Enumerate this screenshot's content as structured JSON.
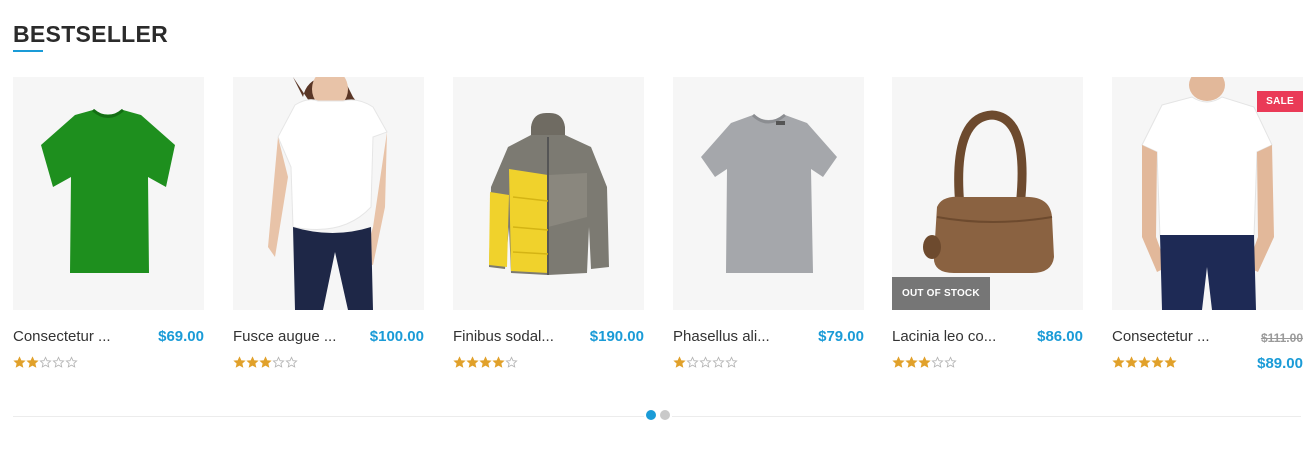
{
  "section": {
    "title": "BESTSELLER"
  },
  "products": [
    {
      "name": "Consectetur ...",
      "price": "$69.00",
      "rating": 2,
      "image": "green-tshirt"
    },
    {
      "name": "Fusce augue ...",
      "price": "$100.00",
      "rating": 3,
      "image": "woman-white-tshirt"
    },
    {
      "name": "Finibus sodal...",
      "price": "$190.00",
      "rating": 4,
      "image": "yellow-grey-jacket"
    },
    {
      "name": "Phasellus ali...",
      "price": "$79.00",
      "rating": 1,
      "image": "grey-tshirt"
    },
    {
      "name": "Lacinia leo co...",
      "price": "$86.00",
      "rating": 3,
      "image": "brown-handbag",
      "badge": "OUT OF STOCK"
    },
    {
      "name": "Consectetur ...",
      "old_price": "$111.00",
      "price": "$89.00",
      "rating": 5,
      "image": "man-white-tshirt",
      "badge": "SALE"
    }
  ],
  "pagination": {
    "pages": 2,
    "active": 1
  },
  "colors": {
    "accent": "#1a9bd7",
    "sale": "#ea3a57",
    "out_of_stock": "#767676",
    "star": "#e1a12a"
  }
}
